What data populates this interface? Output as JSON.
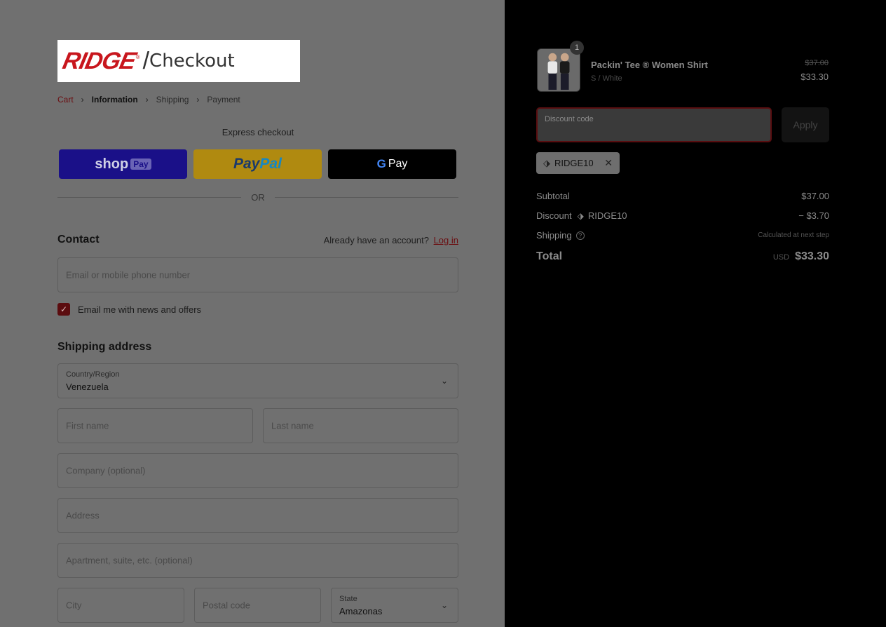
{
  "logo": {
    "brand": "RIDGE",
    "registered": "®",
    "slash": "/",
    "suffix": "Checkout"
  },
  "breadcrumb": {
    "cart": "Cart",
    "information": "Information",
    "shipping": "Shipping",
    "payment": "Payment"
  },
  "express": {
    "label": "Express checkout",
    "shop_pay": {
      "shop": "shop",
      "pay": "Pay"
    },
    "paypal": {
      "pay": "Pay",
      "pal": "Pal"
    },
    "gpay": {
      "g": "G",
      "pay": "Pay"
    },
    "or": "OR"
  },
  "contact": {
    "title": "Contact",
    "account_prompt": "Already have an account?",
    "login_link": "Log in",
    "email_placeholder": "Email or mobile phone number",
    "newsletter_label": "Email me with news and offers",
    "newsletter_checked": true
  },
  "shipping": {
    "title": "Shipping address",
    "country_label": "Country/Region",
    "country_value": "Venezuela",
    "first_name_placeholder": "First name",
    "last_name_placeholder": "Last name",
    "company_placeholder": "Company (optional)",
    "address_placeholder": "Address",
    "apartment_placeholder": "Apartment, suite, etc. (optional)",
    "city_placeholder": "City",
    "postal_placeholder": "Postal code",
    "state_label": "State",
    "state_value": "Amazonas"
  },
  "cart": {
    "item": {
      "quantity": "1",
      "name": "Packin' Tee ® Women Shirt",
      "variant": "S / White",
      "original_price": "$37.00",
      "price": "$33.30"
    },
    "discount_label": "Discount code",
    "apply_label": "Apply",
    "applied_code": "RIDGE10",
    "summary": {
      "subtotal_label": "Subtotal",
      "subtotal_value": "$37.00",
      "discount_label": "Discount",
      "discount_code": "RIDGE10",
      "discount_value": "− $3.70",
      "shipping_label": "Shipping",
      "shipping_value": "Calculated at next step",
      "total_label": "Total",
      "currency": "USD",
      "total_value": "$33.30"
    }
  },
  "colors": {
    "brand_red": "#c8161d",
    "link": "#6b0d10",
    "shop_pay": "#1a1088",
    "paypal": "#b08a10"
  }
}
